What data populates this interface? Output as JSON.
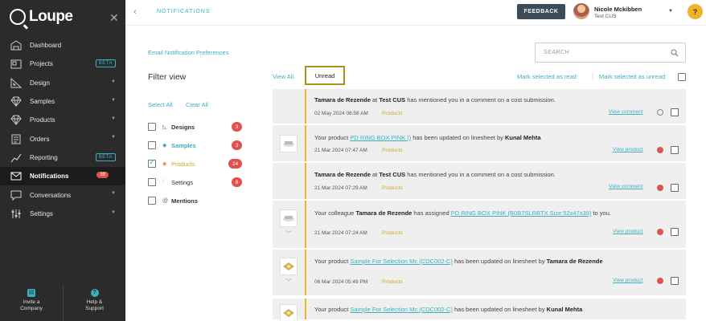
{
  "app": {
    "logo_text": "Loupe",
    "close_icon": "close-icon"
  },
  "sidebar": {
    "items": [
      {
        "label": "Dashboard",
        "icon": "dashboard-icon"
      },
      {
        "label": "Projects",
        "icon": "projects-icon",
        "badge": "BETA"
      },
      {
        "label": "Design",
        "icon": "design-icon",
        "chevron": "▼"
      },
      {
        "label": "Samples",
        "icon": "diamond-icon",
        "chevron": "▼"
      },
      {
        "label": "Products",
        "icon": "diamond-icon",
        "chevron": "▼"
      },
      {
        "label": "Orders",
        "icon": "orders-icon",
        "chevron": "▼"
      },
      {
        "label": "Reporting",
        "icon": "reporting-icon",
        "badge": "BETA"
      },
      {
        "label": "Notifications",
        "icon": "mail-icon",
        "count": "38",
        "active": true
      },
      {
        "label": "Conversations",
        "icon": "chat-icon",
        "chevron": "▼"
      },
      {
        "label": "Settings",
        "icon": "sliders-icon",
        "chevron": "▼"
      }
    ],
    "bottom": {
      "invite_line1": "Invite a",
      "invite_line2": "Company",
      "help_line1": "Help &",
      "help_line2": "Support"
    }
  },
  "topbar": {
    "breadcrumb": "NOTIFICATIONS",
    "feedback": "FEEDBACK",
    "user_name": "Nicole Mckibben",
    "user_org": "Test CUS",
    "help": "?"
  },
  "page": {
    "pref_link": "Email Notification Preferences",
    "search_placeholder": "SEARCH",
    "filter_title": "Filter view",
    "select_all": "Select All",
    "clear_all": "Clear All",
    "filters": [
      {
        "label": "Designs",
        "count": "3",
        "checked": false
      },
      {
        "label": "Samples",
        "count": "3",
        "checked": false
      },
      {
        "label": "Products",
        "count": "24",
        "checked": true
      },
      {
        "label": "Settings",
        "count": "8",
        "checked": false
      },
      {
        "label": "Mentions",
        "count": "",
        "checked": false
      }
    ],
    "tab_all": "View All",
    "tab_unread": "Unread",
    "mark_read": "Mark selected as read",
    "mark_unread": "Mark selected as unread"
  },
  "notifications": [
    {
      "m1": "Tamara de Rezende",
      "m2": " at ",
      "m3": "Test CUS",
      "m4": " has mentioned you in a comment on a cost submission.",
      "date": "02 May 2024 06:56 AM",
      "category": "Products",
      "action": "View comment",
      "status": "read"
    },
    {
      "m1": "Your product ",
      "link": "PD RING BOX PINK ()",
      "m2": " has been updated on linesheet by ",
      "m3": "Kunal Mehta",
      "date": "21 Mar 2024 07:47 AM",
      "category": "Products",
      "action": "View product",
      "status": "unread"
    },
    {
      "m1": "Tamara de Rezende",
      "m2": " at ",
      "m3": "Test CUS",
      "m4": " has mentioned you in a comment on a cost submission.",
      "date": "21 Mar 2024 07:29 AM",
      "category": "Products",
      "action": "View comment",
      "status": "unread"
    },
    {
      "m1": "Your colleague ",
      "m2": "Tamara de Rezende",
      "m3": " has assigned ",
      "link": "PD RING BOX PINK (B0B7SLRBTX Size 52x47x39)",
      "m4": " to you.",
      "date": "21 Mar 2024 07:24 AM",
      "category": "Products",
      "action": "View product",
      "status": "unread"
    },
    {
      "m1": "Your product ",
      "link": "Sample For Selection Mc (CDC002-C)",
      "m2": " has been updated on linesheet by ",
      "m3": "Tamara de Rezende",
      "date": "06 Mar 2024 05:49 PM",
      "category": "Products",
      "action": "View product",
      "status": "unread"
    },
    {
      "m1": "Your product ",
      "link": "Sample For Selection Mc (CDC002-C)",
      "m2": " has been updated on linesheet by ",
      "m3": "Kunal Mehta"
    }
  ],
  "colors": {
    "accent": "#3ab0c0",
    "sidebar_bg": "#2b2b2b",
    "badge_red": "#e0524e",
    "highlight": "#f0b429"
  }
}
